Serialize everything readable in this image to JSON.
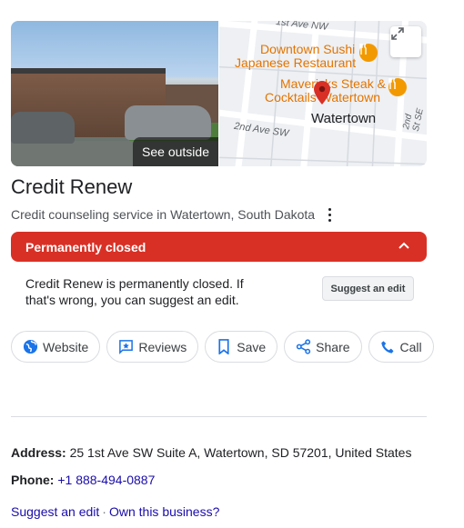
{
  "photo": {
    "see_outside_label": "See outside"
  },
  "map": {
    "streets": [
      "1st Ave NW",
      "2nd Ave SW",
      "2nd St SE"
    ],
    "places": [
      {
        "line1": "Downtown Sushi",
        "line2": "Japanese Restaurant",
        "color": "#e37400"
      },
      {
        "line1": "Mavericks Steak &",
        "line2": "Cocktails Watertown",
        "color": "#e37400"
      }
    ],
    "city_label": "Watertown",
    "pin_color": "#d93025"
  },
  "business": {
    "name": "Credit Renew",
    "category": "Credit counseling service in Watertown, South Dakota"
  },
  "status": {
    "label": "Permanently closed",
    "color": "#d93025",
    "message": "Credit Renew is permanently closed. If that's wrong, you can suggest an edit.",
    "suggest_edit_label": "Suggest an edit"
  },
  "actions": [
    {
      "label": "Website",
      "icon": "globe-icon"
    },
    {
      "label": "Reviews",
      "icon": "reviews-icon"
    },
    {
      "label": "Save",
      "icon": "bookmark-icon"
    },
    {
      "label": "Share",
      "icon": "share-icon"
    },
    {
      "label": "Call",
      "icon": "phone-icon"
    }
  ],
  "details": {
    "address_label": "Address:",
    "address_value": "25 1st Ave SW Suite A, Watertown, SD 57201, United States",
    "phone_label": "Phone:",
    "phone_value": "+1 888-494-0887"
  },
  "footer": {
    "suggest_edit": "Suggest an edit",
    "separator": "·",
    "own_business": "Own this business?"
  },
  "colors": {
    "accent_blue": "#1a73e8",
    "link": "#1a0dab"
  }
}
